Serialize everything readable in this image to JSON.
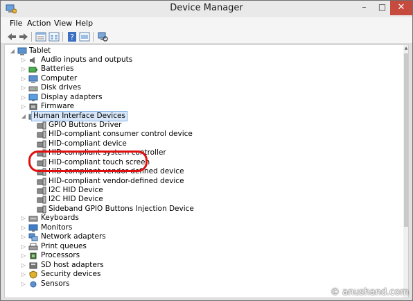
{
  "window": {
    "title": "Device Manager"
  },
  "menu": [
    "File",
    "Action",
    "View",
    "Help"
  ],
  "tree": {
    "root": "Tablet",
    "categories_before": [
      {
        "label": "Audio inputs and outputs",
        "icon": "speaker-icon"
      },
      {
        "label": "Batteries",
        "icon": "battery-icon"
      },
      {
        "label": "Computer",
        "icon": "computer-icon"
      },
      {
        "label": "Disk drives",
        "icon": "disk-icon"
      },
      {
        "label": "Display adapters",
        "icon": "display-icon"
      },
      {
        "label": "Firmware",
        "icon": "firmware-icon"
      }
    ],
    "expanded": {
      "label": "Human Interface Devices",
      "children": [
        "GPIO Buttons Driver",
        "HID-compliant consumer control device",
        "HID-compliant device",
        "HID-compliant system controller",
        "HID-compliant touch screen",
        "HID-compliant vendor-defined device",
        "HID-compliant vendor-defined device",
        "I2C HID Device",
        "I2C HID Device",
        "Sideband GPIO Buttons Injection Device"
      ]
    },
    "categories_after": [
      {
        "label": "Keyboards",
        "icon": "keyboard-icon"
      },
      {
        "label": "Monitors",
        "icon": "monitor-icon"
      },
      {
        "label": "Network adapters",
        "icon": "network-icon"
      },
      {
        "label": "Print queues",
        "icon": "printer-icon"
      },
      {
        "label": "Processors",
        "icon": "processor-icon"
      },
      {
        "label": "SD host adapters",
        "icon": "sd-card-icon"
      },
      {
        "label": "Security devices",
        "icon": "security-icon"
      },
      {
        "label": "Sensors",
        "icon": "sensor-icon"
      }
    ]
  },
  "watermark": "© anushand.com",
  "colors": {
    "annotation": "#e01010",
    "close_button": "#c74a3f",
    "selection": "#d8e8fa"
  }
}
